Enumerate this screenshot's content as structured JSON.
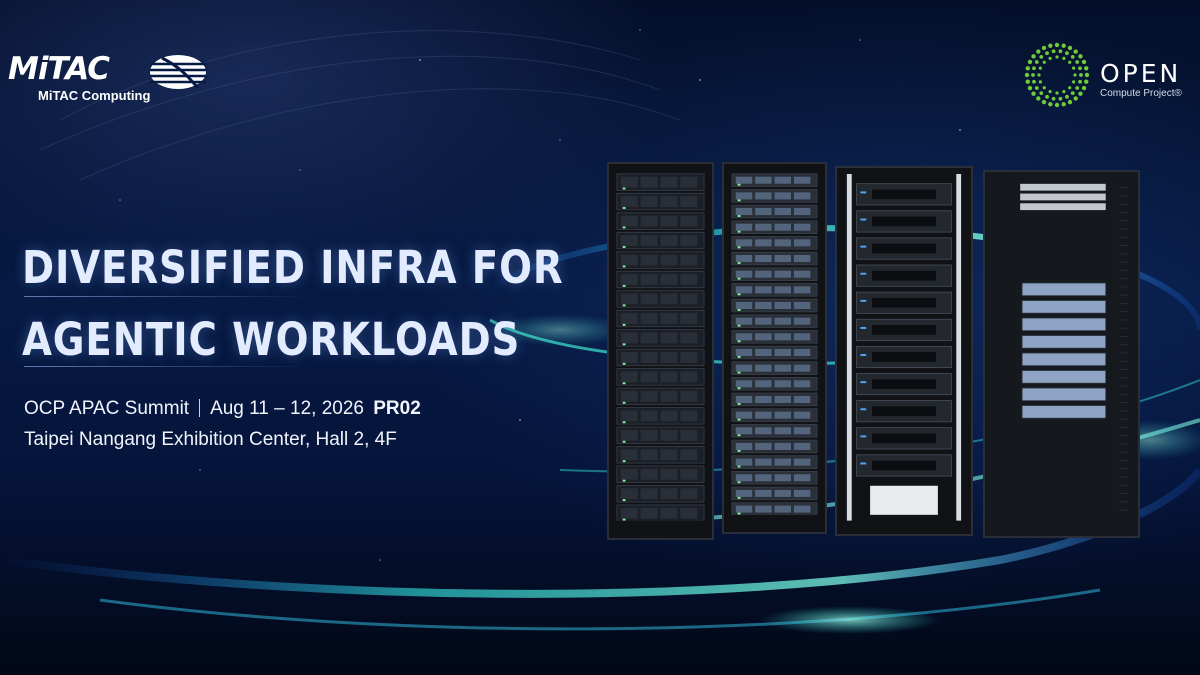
{
  "brand": {
    "mitac_logo": "MiTAC",
    "mitac_subtitle": "MiTAC Computing",
    "ocp_logo": "OPEN",
    "ocp_subtitle": "Compute Project®"
  },
  "headline": {
    "line1": "DIVERSIFIED INFRA FOR",
    "line2": "AGENTIC WORKLOADS"
  },
  "event": {
    "name": "OCP APAC Summit",
    "dates": "Aug 11 – 12, 2026",
    "booth": "PR02",
    "venue": "Taipei Nangang Exhibition Center, Hall 2, 4F"
  },
  "icons": [
    "mitac-globe-icon",
    "ocp-ring-icon"
  ],
  "colors": {
    "background": "#061a44",
    "headline": "#e3ecff",
    "swoosh": "#38e0c8",
    "ocp_green": "#6ecb3a"
  }
}
